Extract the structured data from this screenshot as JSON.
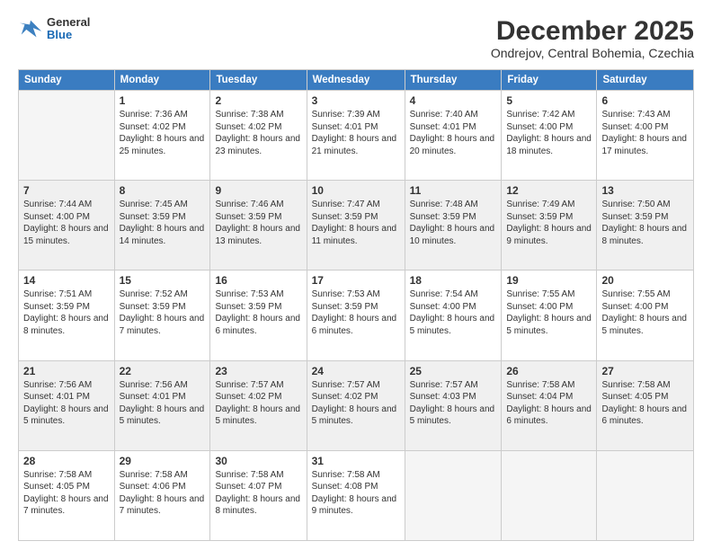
{
  "logo": {
    "general": "General",
    "blue": "Blue"
  },
  "title": "December 2025",
  "subtitle": "Ondrejov, Central Bohemia, Czechia",
  "days_header": [
    "Sunday",
    "Monday",
    "Tuesday",
    "Wednesday",
    "Thursday",
    "Friday",
    "Saturday"
  ],
  "weeks": [
    [
      {
        "num": "",
        "empty": true
      },
      {
        "num": "1",
        "sunrise": "Sunrise: 7:36 AM",
        "sunset": "Sunset: 4:02 PM",
        "daylight": "Daylight: 8 hours and 25 minutes."
      },
      {
        "num": "2",
        "sunrise": "Sunrise: 7:38 AM",
        "sunset": "Sunset: 4:02 PM",
        "daylight": "Daylight: 8 hours and 23 minutes."
      },
      {
        "num": "3",
        "sunrise": "Sunrise: 7:39 AM",
        "sunset": "Sunset: 4:01 PM",
        "daylight": "Daylight: 8 hours and 21 minutes."
      },
      {
        "num": "4",
        "sunrise": "Sunrise: 7:40 AM",
        "sunset": "Sunset: 4:01 PM",
        "daylight": "Daylight: 8 hours and 20 minutes."
      },
      {
        "num": "5",
        "sunrise": "Sunrise: 7:42 AM",
        "sunset": "Sunset: 4:00 PM",
        "daylight": "Daylight: 8 hours and 18 minutes."
      },
      {
        "num": "6",
        "sunrise": "Sunrise: 7:43 AM",
        "sunset": "Sunset: 4:00 PM",
        "daylight": "Daylight: 8 hours and 17 minutes."
      }
    ],
    [
      {
        "num": "7",
        "sunrise": "Sunrise: 7:44 AM",
        "sunset": "Sunset: 4:00 PM",
        "daylight": "Daylight: 8 hours and 15 minutes."
      },
      {
        "num": "8",
        "sunrise": "Sunrise: 7:45 AM",
        "sunset": "Sunset: 3:59 PM",
        "daylight": "Daylight: 8 hours and 14 minutes."
      },
      {
        "num": "9",
        "sunrise": "Sunrise: 7:46 AM",
        "sunset": "Sunset: 3:59 PM",
        "daylight": "Daylight: 8 hours and 13 minutes."
      },
      {
        "num": "10",
        "sunrise": "Sunrise: 7:47 AM",
        "sunset": "Sunset: 3:59 PM",
        "daylight": "Daylight: 8 hours and 11 minutes."
      },
      {
        "num": "11",
        "sunrise": "Sunrise: 7:48 AM",
        "sunset": "Sunset: 3:59 PM",
        "daylight": "Daylight: 8 hours and 10 minutes."
      },
      {
        "num": "12",
        "sunrise": "Sunrise: 7:49 AM",
        "sunset": "Sunset: 3:59 PM",
        "daylight": "Daylight: 8 hours and 9 minutes."
      },
      {
        "num": "13",
        "sunrise": "Sunrise: 7:50 AM",
        "sunset": "Sunset: 3:59 PM",
        "daylight": "Daylight: 8 hours and 8 minutes."
      }
    ],
    [
      {
        "num": "14",
        "sunrise": "Sunrise: 7:51 AM",
        "sunset": "Sunset: 3:59 PM",
        "daylight": "Daylight: 8 hours and 8 minutes."
      },
      {
        "num": "15",
        "sunrise": "Sunrise: 7:52 AM",
        "sunset": "Sunset: 3:59 PM",
        "daylight": "Daylight: 8 hours and 7 minutes."
      },
      {
        "num": "16",
        "sunrise": "Sunrise: 7:53 AM",
        "sunset": "Sunset: 3:59 PM",
        "daylight": "Daylight: 8 hours and 6 minutes."
      },
      {
        "num": "17",
        "sunrise": "Sunrise: 7:53 AM",
        "sunset": "Sunset: 3:59 PM",
        "daylight": "Daylight: 8 hours and 6 minutes."
      },
      {
        "num": "18",
        "sunrise": "Sunrise: 7:54 AM",
        "sunset": "Sunset: 4:00 PM",
        "daylight": "Daylight: 8 hours and 5 minutes."
      },
      {
        "num": "19",
        "sunrise": "Sunrise: 7:55 AM",
        "sunset": "Sunset: 4:00 PM",
        "daylight": "Daylight: 8 hours and 5 minutes."
      },
      {
        "num": "20",
        "sunrise": "Sunrise: 7:55 AM",
        "sunset": "Sunset: 4:00 PM",
        "daylight": "Daylight: 8 hours and 5 minutes."
      }
    ],
    [
      {
        "num": "21",
        "sunrise": "Sunrise: 7:56 AM",
        "sunset": "Sunset: 4:01 PM",
        "daylight": "Daylight: 8 hours and 5 minutes."
      },
      {
        "num": "22",
        "sunrise": "Sunrise: 7:56 AM",
        "sunset": "Sunset: 4:01 PM",
        "daylight": "Daylight: 8 hours and 5 minutes."
      },
      {
        "num": "23",
        "sunrise": "Sunrise: 7:57 AM",
        "sunset": "Sunset: 4:02 PM",
        "daylight": "Daylight: 8 hours and 5 minutes."
      },
      {
        "num": "24",
        "sunrise": "Sunrise: 7:57 AM",
        "sunset": "Sunset: 4:02 PM",
        "daylight": "Daylight: 8 hours and 5 minutes."
      },
      {
        "num": "25",
        "sunrise": "Sunrise: 7:57 AM",
        "sunset": "Sunset: 4:03 PM",
        "daylight": "Daylight: 8 hours and 5 minutes."
      },
      {
        "num": "26",
        "sunrise": "Sunrise: 7:58 AM",
        "sunset": "Sunset: 4:04 PM",
        "daylight": "Daylight: 8 hours and 6 minutes."
      },
      {
        "num": "27",
        "sunrise": "Sunrise: 7:58 AM",
        "sunset": "Sunset: 4:05 PM",
        "daylight": "Daylight: 8 hours and 6 minutes."
      }
    ],
    [
      {
        "num": "28",
        "sunrise": "Sunrise: 7:58 AM",
        "sunset": "Sunset: 4:05 PM",
        "daylight": "Daylight: 8 hours and 7 minutes."
      },
      {
        "num": "29",
        "sunrise": "Sunrise: 7:58 AM",
        "sunset": "Sunset: 4:06 PM",
        "daylight": "Daylight: 8 hours and 7 minutes."
      },
      {
        "num": "30",
        "sunrise": "Sunrise: 7:58 AM",
        "sunset": "Sunset: 4:07 PM",
        "daylight": "Daylight: 8 hours and 8 minutes."
      },
      {
        "num": "31",
        "sunrise": "Sunrise: 7:58 AM",
        "sunset": "Sunset: 4:08 PM",
        "daylight": "Daylight: 8 hours and 9 minutes."
      },
      {
        "num": "",
        "empty": true
      },
      {
        "num": "",
        "empty": true
      },
      {
        "num": "",
        "empty": true
      }
    ]
  ]
}
